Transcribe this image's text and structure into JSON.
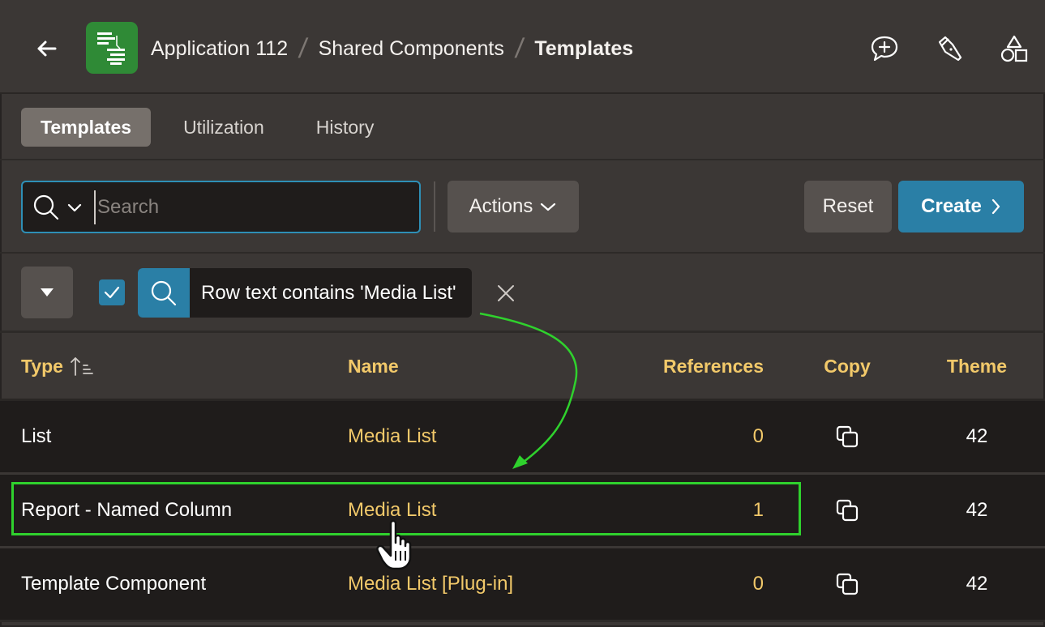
{
  "header": {
    "back_icon": "back-arrow-icon",
    "app_icon": "application-icon",
    "breadcrumb": [
      "Application 112",
      "Shared Components",
      "Templates"
    ],
    "actions": [
      "add-comment-icon",
      "flashlight-icon",
      "shapes-icon"
    ]
  },
  "tabs": [
    {
      "label": "Templates",
      "active": true
    },
    {
      "label": "Utilization",
      "active": false
    },
    {
      "label": "History",
      "active": false
    }
  ],
  "toolbar": {
    "search_placeholder": "Search",
    "actions_label": "Actions",
    "reset_label": "Reset",
    "create_label": "Create"
  },
  "filter": {
    "enabled": true,
    "text": "Row text contains 'Media List'"
  },
  "table": {
    "columns": [
      "Type",
      "Name",
      "References",
      "Copy",
      "Theme"
    ],
    "sort": {
      "column": "Type",
      "direction": "ascending"
    },
    "rows": [
      {
        "type": "List",
        "name": "Media List",
        "references": "0",
        "theme": "42"
      },
      {
        "type": "Report - Named Column",
        "name": "Media List",
        "references": "1",
        "theme": "42"
      },
      {
        "type": "Template Component",
        "name": "Media List [Plug-in]",
        "references": "0",
        "theme": "42"
      }
    ]
  },
  "annotation": {
    "highlighted_row": 1,
    "highlight_color": "#2fd12d",
    "cursor": "hand-pointer-icon"
  },
  "colors": {
    "accent": "#2a7fa6",
    "link": "#f2c96a",
    "app_icon_bg": "#2f8a36"
  }
}
